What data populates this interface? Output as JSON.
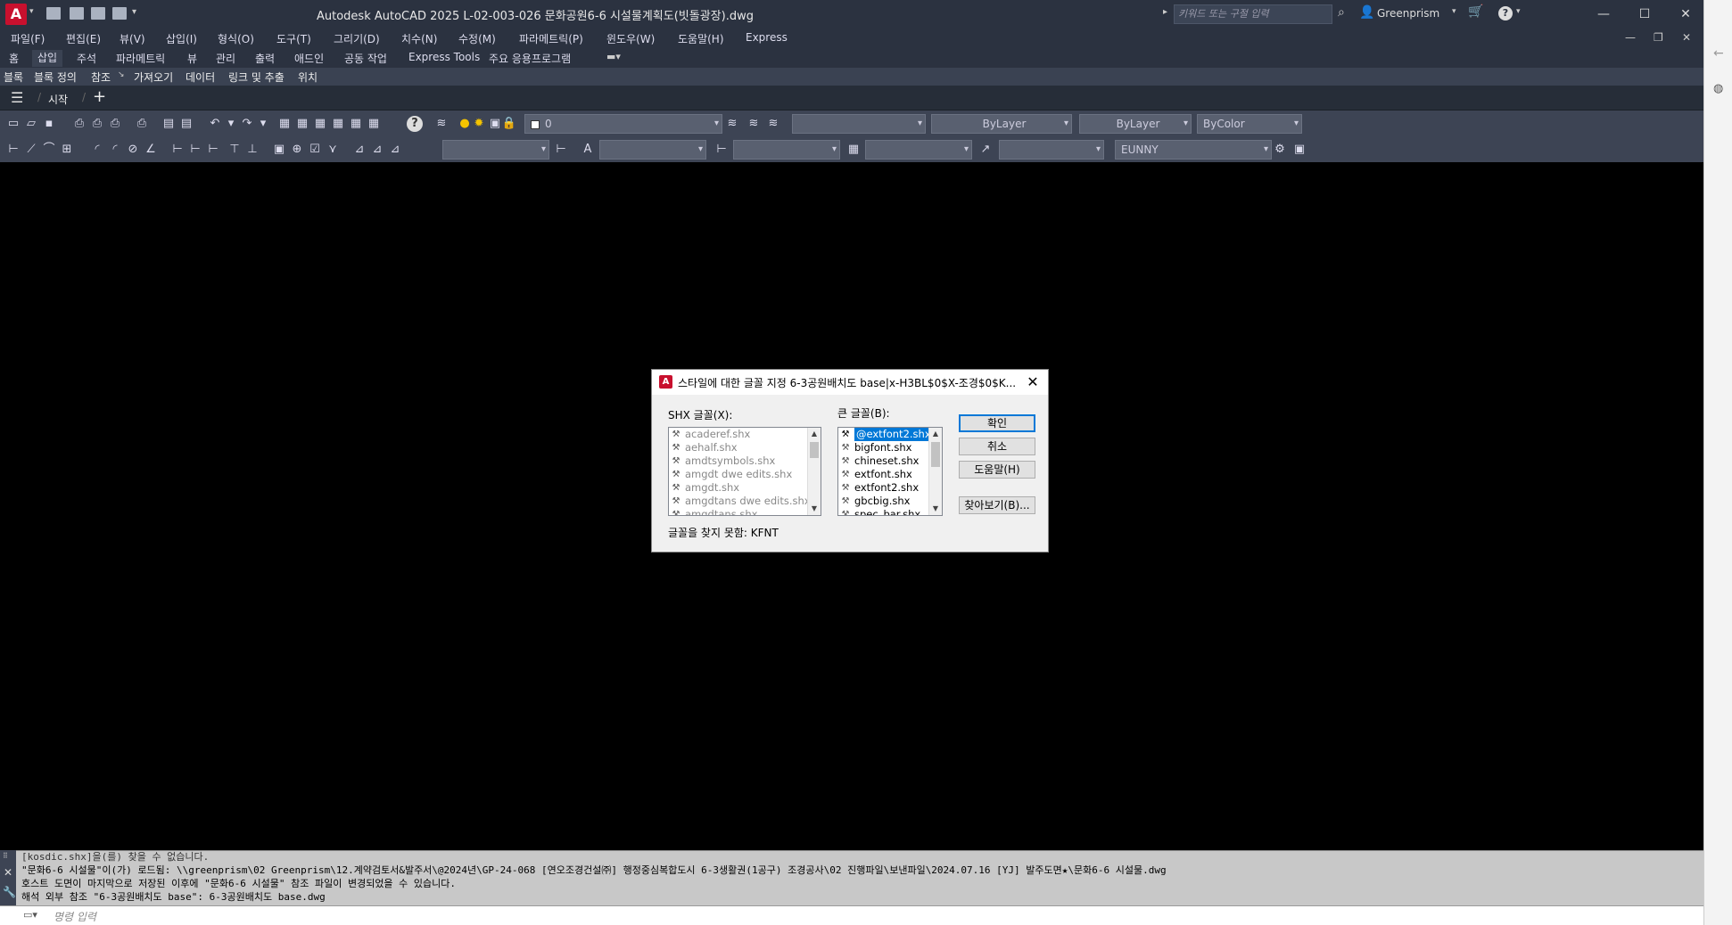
{
  "titlebar": {
    "app_icon": "A",
    "title": "Autodesk AutoCAD 2025    L-02-003-026 문화공원6-6 시설물계획도(빗돌광장).dwg",
    "search_placeholder": "키워드 또는 구절 입력",
    "user": "Greenprism"
  },
  "menu": [
    "파일(F)",
    "편집(E)",
    "뷰(V)",
    "삽입(I)",
    "형식(O)",
    "도구(T)",
    "그리기(D)",
    "치수(N)",
    "수정(M)",
    "파라메트릭(P)",
    "윈도우(W)",
    "도움말(H)",
    "Express"
  ],
  "ribbon_tabs": [
    "홈",
    "삽입",
    "주석",
    "파라메트릭",
    "뷰",
    "관리",
    "출력",
    "애드인",
    "공동 작업",
    "Express Tools",
    "주요 응용프로그램"
  ],
  "active_tab": "삽입",
  "panels": [
    "블록",
    "블록 정의",
    "참조",
    "가져오기",
    "데이터",
    "링크 및 추출",
    "위치"
  ],
  "file_tabs": {
    "start": "시작"
  },
  "toolbar1": {
    "layer": "0",
    "color_combo": "",
    "linetype": "ByLayer",
    "lineweight": "ByLayer",
    "plotstyle": "ByColor"
  },
  "toolbar2": {
    "textstyle": "",
    "dimstyle": "",
    "tablestyle": "",
    "mleaderstyle": "",
    "style": "EUNNY"
  },
  "command": {
    "lines": [
      "[kosdic.shx]을(를) 찾을 수 없습니다.",
      "\"문화6-6 시설물\"이(가) 로드됨: \\\\greenprism\\02 Greenprism\\12.계약검토서&발주서\\@2024년\\GP-24-068 [연오조경건설㈜] 행정중심복합도시 6-3생활권(1공구) 조경공사\\02 진행파일\\보낸파일\\2024.07.16 [YJ] 발주도면★\\문화6-6 시설물.dwg",
      "호스트 도면이 마지막으로 저장된 이후에 \"문화6-6 시설물\" 참조 파일이 변경되었을 수 있습니다.",
      "해석 외부 참조 \"6-3공원배치도 base\": 6-3공원배치도 base.dwg"
    ],
    "input_placeholder": "명령 입력"
  },
  "dialog": {
    "title": "스타일에 대한 글꼴 지정 6-3공원배치도 base|x-H3BL$0$X-조경$0$K...",
    "shx_label": "SHX 글꼴(X):",
    "shx_fonts": [
      "acaderef.shx",
      "aehalf.shx",
      "amdtsymbols.shx",
      "amgdt dwe edits.shx",
      "amgdt.shx",
      "amgdtans dwe edits.shx",
      "amgdtans.shx"
    ],
    "big_label": "큰 글꼴(B):",
    "big_fonts": [
      "@extfont2.shx",
      "bigfont.shx",
      "chineset.shx",
      "extfont.shx",
      "extfont2.shx",
      "gbcbig.shx",
      "spec_bar.shx"
    ],
    "selected_big": "@extfont2.shx",
    "ok": "확인",
    "cancel": "취소",
    "help": "도움말(H)",
    "browse": "찾아보기(B)...",
    "status": "글꼴을 찾지 못함: KFNT"
  }
}
